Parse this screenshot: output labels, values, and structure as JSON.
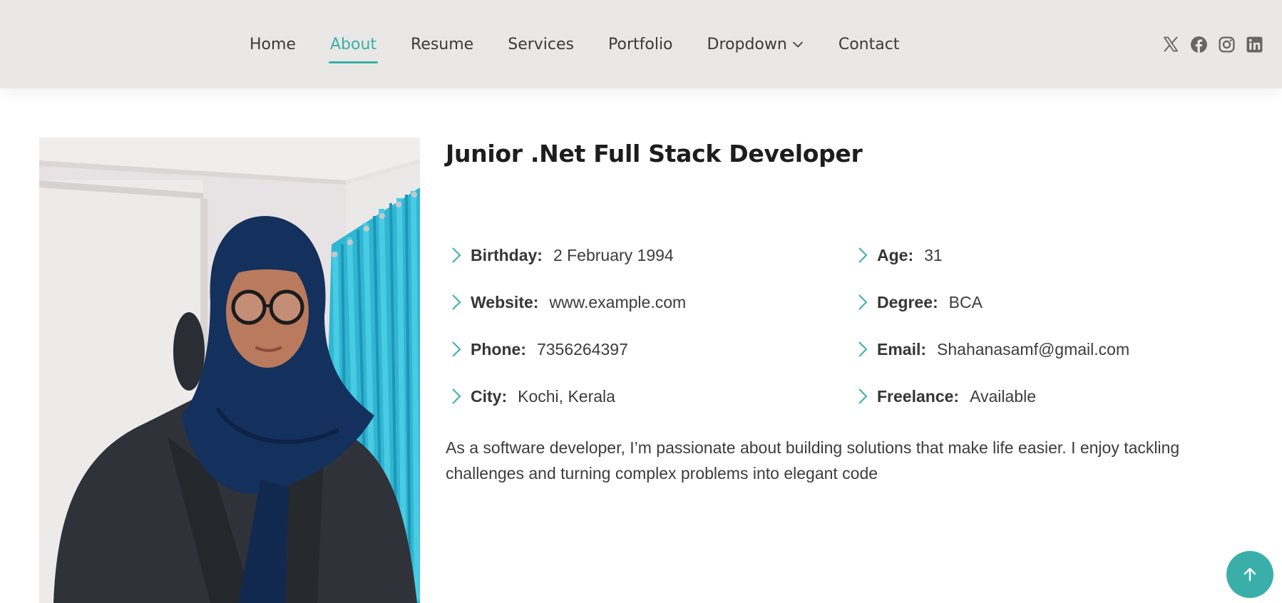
{
  "nav": {
    "items": [
      {
        "label": "Home"
      },
      {
        "label": "About"
      },
      {
        "label": "Resume"
      },
      {
        "label": "Services"
      },
      {
        "label": "Portfolio"
      },
      {
        "label": "Dropdown"
      },
      {
        "label": "Contact"
      }
    ],
    "active": "About",
    "social_icons": [
      "x-icon",
      "facebook-icon",
      "instagram-icon",
      "linkedin-icon"
    ]
  },
  "about": {
    "title": "Junior .Net Full Stack Developer",
    "left": [
      {
        "label": "Birthday:",
        "value": "2 February 1994"
      },
      {
        "label": "Website:",
        "value": "www.example.com"
      },
      {
        "label": "Phone:",
        "value": "7356264397"
      },
      {
        "label": "City:",
        "value": "Kochi, Kerala"
      }
    ],
    "right": [
      {
        "label": "Age:",
        "value": "31"
      },
      {
        "label": "Degree:",
        "value": "BCA"
      },
      {
        "label": "Email:",
        "value": "Shahanasamf@gmail.com"
      },
      {
        "label": "Freelance:",
        "value": "Available"
      }
    ],
    "description": "As a software developer, I’m passionate about building solutions that make life easier. I enjoy tackling challenges and turning complex problems into elegant code"
  },
  "colors": {
    "accent": "#3aafa9",
    "header_bg": "#e9e8e6",
    "text": "#3c3c3c",
    "heading": "#1d1d1d"
  }
}
